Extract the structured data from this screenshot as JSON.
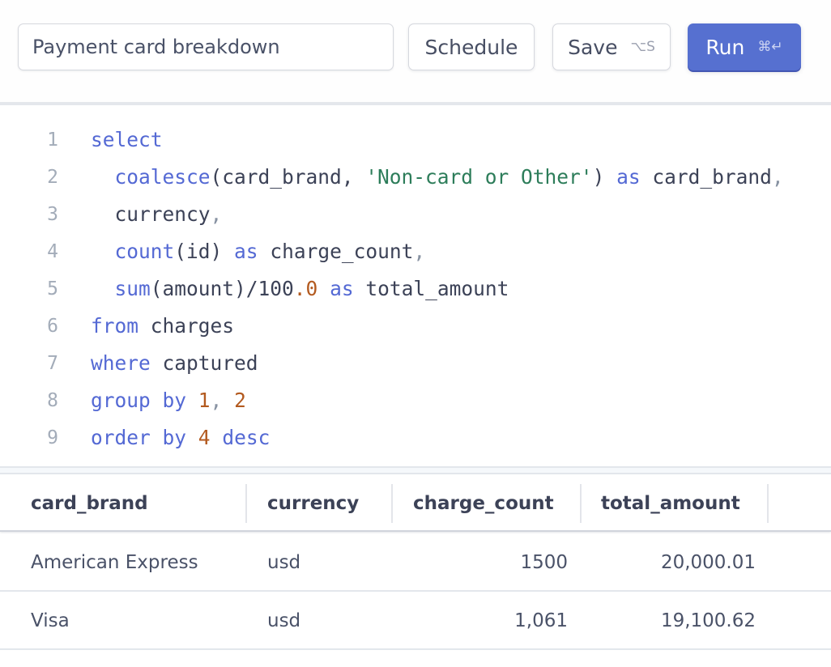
{
  "toolbar": {
    "title_value": "Payment card breakdown",
    "schedule_label": "Schedule",
    "save_label": "Save",
    "save_shortcut": "⌥S",
    "run_label": "Run",
    "run_shortcut": "⌘↵",
    "accent_color": "#5670d0"
  },
  "editor": {
    "line_numbers": [
      "1",
      "2",
      "3",
      "4",
      "5",
      "6",
      "7",
      "8",
      "9"
    ],
    "lines": [
      [
        {
          "t": "kw",
          "v": "select"
        }
      ],
      [
        {
          "t": "plain",
          "v": "  "
        },
        {
          "t": "kw",
          "v": "coalesce"
        },
        {
          "t": "plain",
          "v": "(card_brand, "
        },
        {
          "t": "str",
          "v": "'Non-card or Other'"
        },
        {
          "t": "plain",
          "v": ") "
        },
        {
          "t": "kw",
          "v": "as"
        },
        {
          "t": "plain",
          "v": " card_brand"
        },
        {
          "t": "punct",
          "v": ","
        }
      ],
      [
        {
          "t": "plain",
          "v": "  currency"
        },
        {
          "t": "punct",
          "v": ","
        }
      ],
      [
        {
          "t": "plain",
          "v": "  "
        },
        {
          "t": "kw",
          "v": "count"
        },
        {
          "t": "plain",
          "v": "(id) "
        },
        {
          "t": "kw",
          "v": "as"
        },
        {
          "t": "plain",
          "v": " charge_count"
        },
        {
          "t": "punct",
          "v": ","
        }
      ],
      [
        {
          "t": "plain",
          "v": "  "
        },
        {
          "t": "kw",
          "v": "sum"
        },
        {
          "t": "plain",
          "v": "(amount)/100"
        },
        {
          "t": "num",
          "v": ".0"
        },
        {
          "t": "plain",
          "v": " "
        },
        {
          "t": "kw",
          "v": "as"
        },
        {
          "t": "plain",
          "v": " total_amount"
        }
      ],
      [
        {
          "t": "kw",
          "v": "from"
        },
        {
          "t": "plain",
          "v": " charges"
        }
      ],
      [
        {
          "t": "kw",
          "v": "where"
        },
        {
          "t": "plain",
          "v": " captured"
        }
      ],
      [
        {
          "t": "kw",
          "v": "group by"
        },
        {
          "t": "plain",
          "v": " "
        },
        {
          "t": "num",
          "v": "1"
        },
        {
          "t": "punct",
          "v": ","
        },
        {
          "t": "plain",
          "v": " "
        },
        {
          "t": "num",
          "v": "2"
        }
      ],
      [
        {
          "t": "kw",
          "v": "order by"
        },
        {
          "t": "plain",
          "v": " "
        },
        {
          "t": "num",
          "v": "4"
        },
        {
          "t": "plain",
          "v": " "
        },
        {
          "t": "kw",
          "v": "desc"
        }
      ]
    ]
  },
  "results": {
    "columns": [
      "card_brand",
      "currency",
      "charge_count",
      "total_amount"
    ],
    "rows": [
      [
        "American Express",
        "usd",
        "1500",
        "20,000.01"
      ],
      [
        "Visa",
        "usd",
        "1,061",
        "19,100.62"
      ]
    ]
  }
}
